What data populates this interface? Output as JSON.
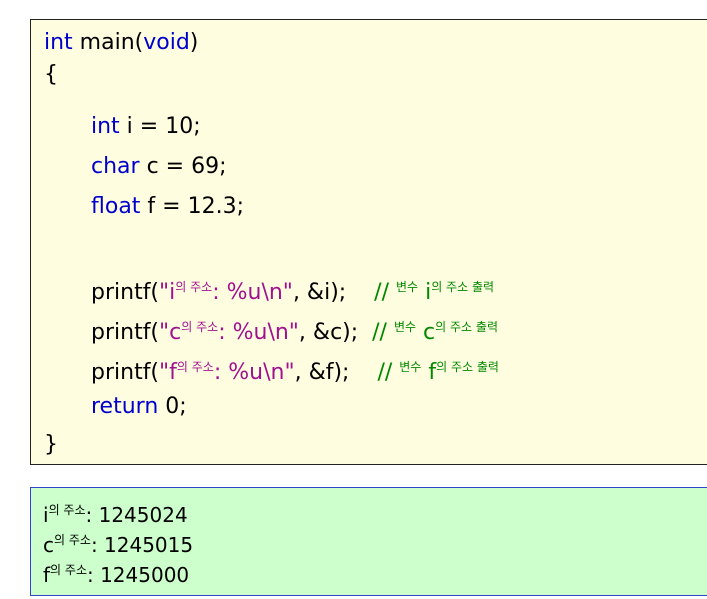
{
  "code": {
    "line1": {
      "kw": "int",
      "text": " main(",
      "kw2": "void",
      "end": ")"
    },
    "line2": "{",
    "line3": {
      "kw": "int",
      "text": " i = 10;"
    },
    "line4": {
      "kw": "char",
      "text": " c = 69;"
    },
    "line5": {
      "kw": "float",
      "text": " f = 12.3;"
    },
    "line7": {
      "pre": "printf(",
      "str_a": "\"i",
      "ko1": "의 주소",
      "str_b": ": %u\\n\"",
      "post": ", &i);    ",
      "cmt_a": "// ",
      "cmt_ko1": "변수",
      "cmt_b": " i",
      "cmt_ko2": "의 주소 출력"
    },
    "line8": {
      "pre": "printf(",
      "str_a": "\"c",
      "ko1": "의 주소",
      "str_b": ": %u\\n\"",
      "post": ", &c);  ",
      "cmt_a": "// ",
      "cmt_ko1": "변수",
      "cmt_b": " c",
      "cmt_ko2": "의 주소 출력"
    },
    "line9": {
      "pre": "printf(",
      "str_a": "\"f",
      "ko1": "의 주소",
      "str_b": ": %u\\n\"",
      "post": ", &f);    ",
      "cmt_a": "// ",
      "cmt_ko1": "변수",
      "cmt_b": " f",
      "cmt_ko2": "의 주소 출력"
    },
    "line10": {
      "kw": "return",
      "text": " 0;"
    },
    "line11": "}"
  },
  "output": {
    "line1": {
      "var": "i",
      "ko": "의 주소",
      "value": ": 1245024"
    },
    "line2": {
      "var": "c",
      "ko": "의 주소",
      "value": ": 1245015"
    },
    "line3": {
      "var": "f",
      "ko": "의 주소",
      "value": ": 1245000"
    }
  },
  "colors": {
    "code_bg": "#fffde0",
    "output_bg": "#ccffcc",
    "keyword": "#0000cc",
    "string": "#a0108f",
    "comment": "#008800"
  }
}
